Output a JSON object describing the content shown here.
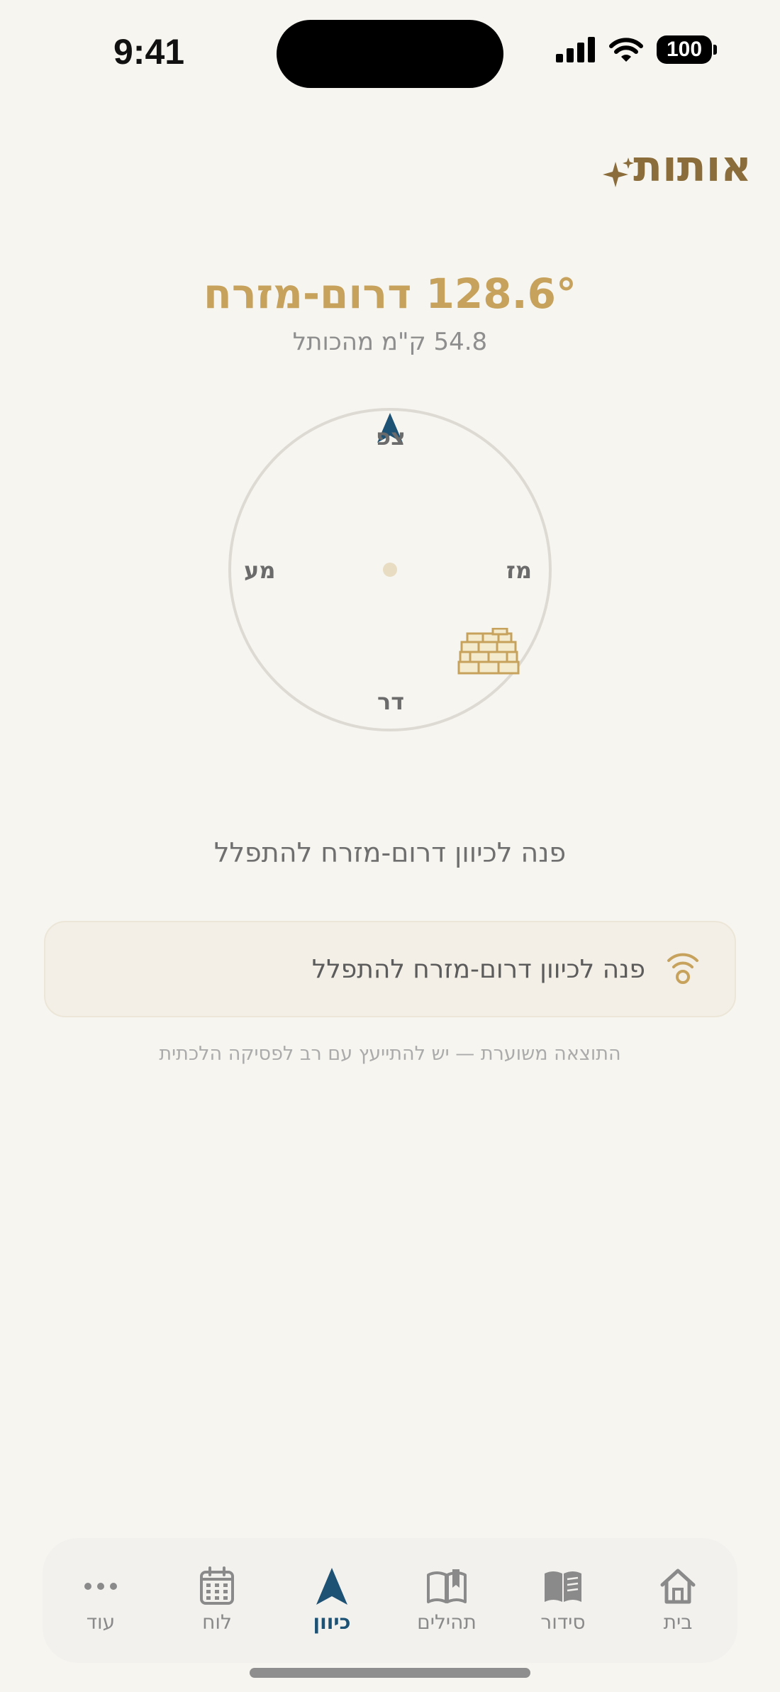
{
  "status": {
    "time": "9:41",
    "battery": "100"
  },
  "header": {
    "title": "אותות",
    "sparkle_icon": "sparkle-icon"
  },
  "qibla": {
    "bearing": "128.6° דרום-מזרח",
    "distance": "54.8 ק\"מ מהכותל"
  },
  "compass": {
    "north": "צפ",
    "east": "מז",
    "south": "דר",
    "west": "מע",
    "needle_icon": "navigation-arrow-icon",
    "target_icon": "western-wall-icon"
  },
  "instruction": "פנה לכיוון דרום-מזרח להתפלל",
  "card": {
    "text": "פנה לכיוון דרום-מזרח להתפלל",
    "icon": "signal-icon"
  },
  "disclaimer": "התוצאה משוערת — יש להתייעץ עם רב לפסיקה הלכתית",
  "tabs": [
    {
      "label": "בית",
      "icon": "home-icon"
    },
    {
      "label": "סידור",
      "icon": "book-icon"
    },
    {
      "label": "תהילים",
      "icon": "open-book-icon"
    },
    {
      "label": "כיוון",
      "icon": "navigation-arrow-icon",
      "active": true
    },
    {
      "label": "לוח",
      "icon": "calendar-icon"
    },
    {
      "label": "עוד",
      "icon": "more-icon"
    }
  ],
  "colors": {
    "accent": "#C6A25C",
    "brand": "#8A6D3B",
    "active": "#1E5274",
    "background": "#F7F5F0"
  }
}
